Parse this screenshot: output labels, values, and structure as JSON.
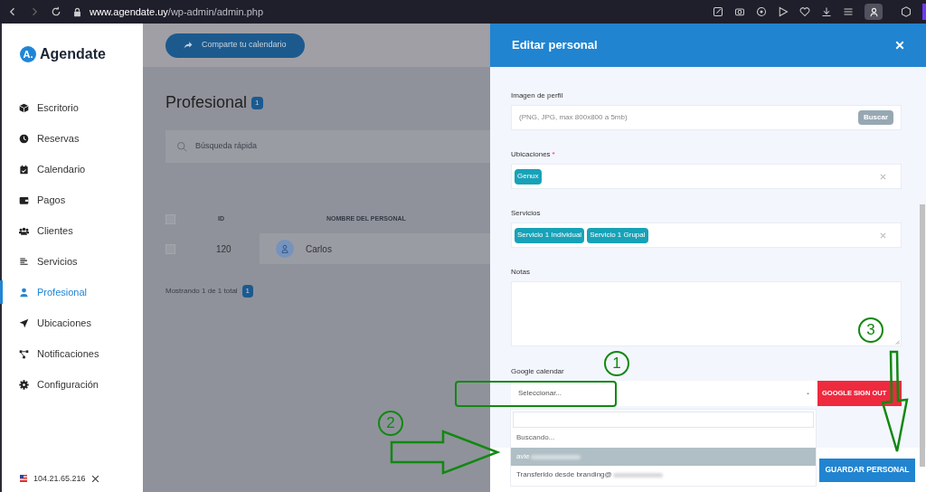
{
  "browser": {
    "url_host": "www.agendate.uy",
    "url_path": "/wp-admin/admin.php"
  },
  "sidebar": {
    "logo_mark": "A.",
    "logo_text": "Agendate",
    "items": [
      {
        "label": "Escritorio",
        "selected": false
      },
      {
        "label": "Reservas",
        "selected": false
      },
      {
        "label": "Calendario",
        "selected": false
      },
      {
        "label": "Pagos",
        "selected": false
      },
      {
        "label": "Clientes",
        "selected": false
      },
      {
        "label": "Servicios",
        "selected": false
      },
      {
        "label": "Profesional",
        "selected": true
      },
      {
        "label": "Ubicaciones",
        "selected": false
      },
      {
        "label": "Notificaciones",
        "selected": false
      },
      {
        "label": "Configuración",
        "selected": false
      }
    ],
    "ip": "104.21.65.216"
  },
  "main": {
    "share_button": "Comparte tu calendario",
    "title": "Profesional",
    "title_count": "1",
    "search_placeholder": "Búsqueda rápida",
    "select_all_checked": false,
    "columns": [
      "ID",
      "NOMBRE DEL PERSONAL"
    ],
    "rows": [
      {
        "checked": false,
        "id": "120",
        "name": "Carlos"
      }
    ],
    "footer_text": "Mostrando 1 de 1 total",
    "footer_page": "1"
  },
  "modal": {
    "title": "Editar personal",
    "fields": [
      {
        "kind": "file",
        "label": "Imagen de perfil",
        "placeholder": "(PNG, JPG, max 800x800 a 5mb)",
        "button": "Buscar"
      },
      {
        "kind": "tags",
        "label": "Ubicaciones",
        "required_mark": "*",
        "tags": [
          "Genux"
        ]
      },
      {
        "kind": "tags",
        "label": "Servicios",
        "tags": [
          "Servicio 1 Individual",
          "Servicio 1 Grupal"
        ]
      },
      {
        "kind": "textarea",
        "label": "Notas"
      },
      {
        "kind": "select",
        "label": "Google calendar",
        "placeholder": "Seleccionar...",
        "button": "GOOGLE SIGN OUT"
      }
    ],
    "dropdown": {
      "status": "Buscando...",
      "options": [
        {
          "label": "avie",
          "selected": true
        },
        {
          "label": "Transferido desde branding@",
          "selected": false
        }
      ]
    },
    "save_button": "GUARDAR PERSONAL"
  },
  "annotations": [
    {
      "label": "1"
    },
    {
      "label": "2"
    },
    {
      "label": "3"
    }
  ]
}
